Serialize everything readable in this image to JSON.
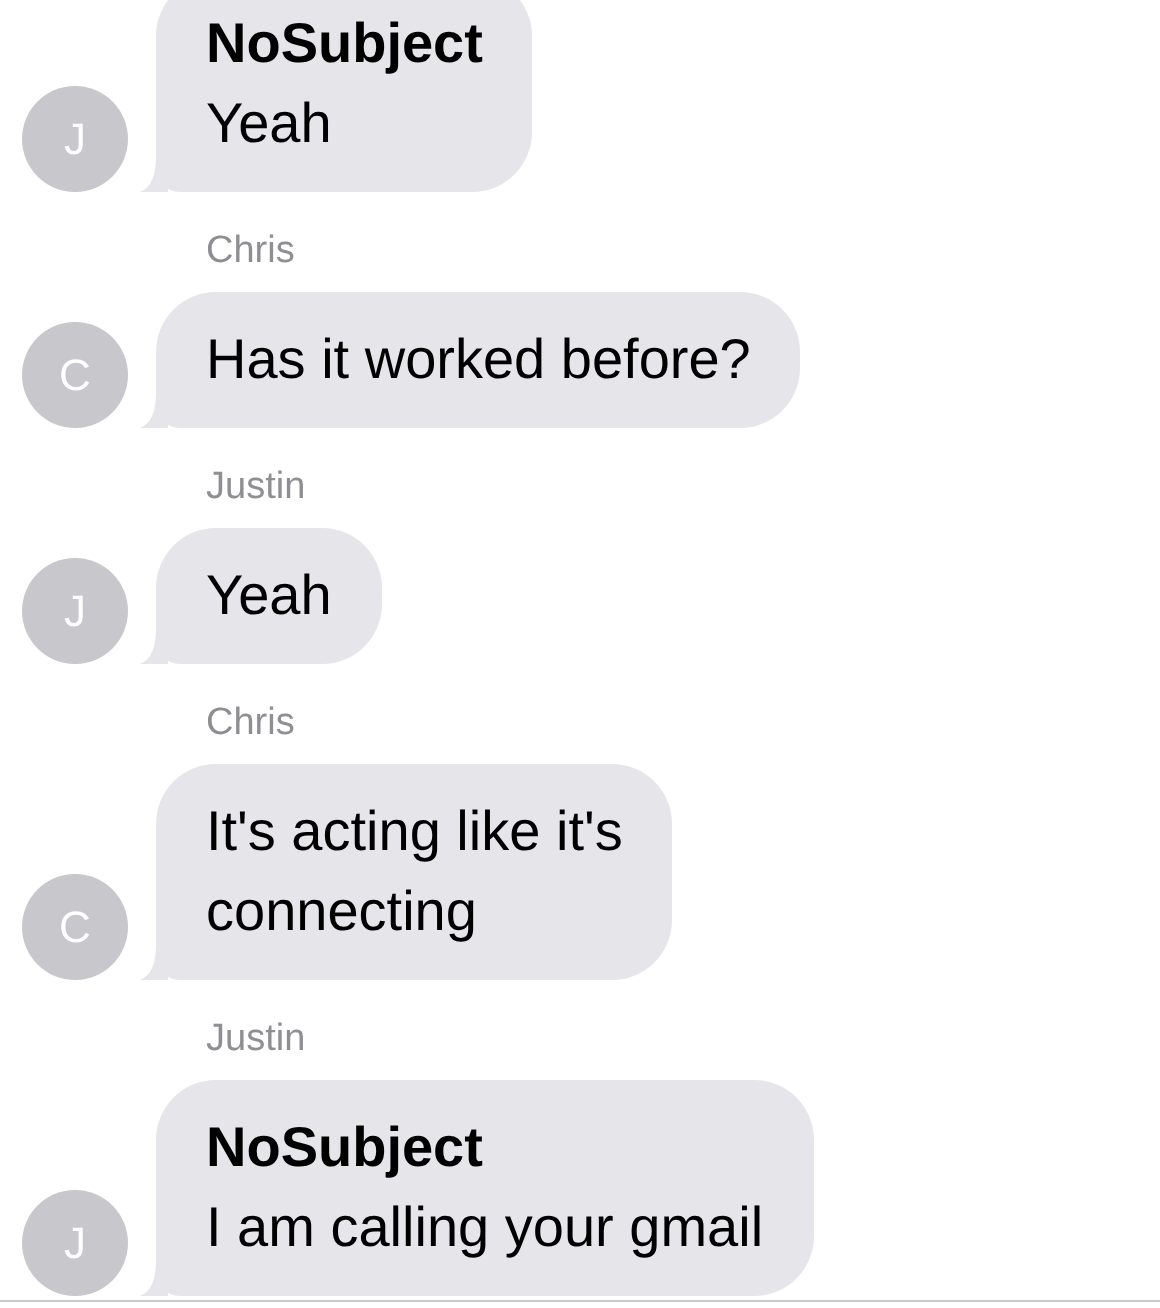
{
  "thread": [
    {
      "kind": "bubble",
      "avatar": "J",
      "subject": "NoSubject",
      "lines": [
        "Yeah"
      ]
    },
    {
      "kind": "sender",
      "text": "Chris"
    },
    {
      "kind": "bubble",
      "avatar": "C",
      "lines": [
        "Has it worked before?"
      ]
    },
    {
      "kind": "sender",
      "text": "Justin"
    },
    {
      "kind": "bubble",
      "avatar": "J",
      "lines": [
        "Yeah"
      ]
    },
    {
      "kind": "sender",
      "text": "Chris"
    },
    {
      "kind": "bubble",
      "avatar": "C",
      "lines": [
        "It's acting like it's",
        "connecting"
      ]
    },
    {
      "kind": "sender",
      "text": "Justin"
    },
    {
      "kind": "bubble",
      "avatar": "J",
      "subject": "NoSubject",
      "lines": [
        "I am calling your gmail"
      ]
    }
  ]
}
